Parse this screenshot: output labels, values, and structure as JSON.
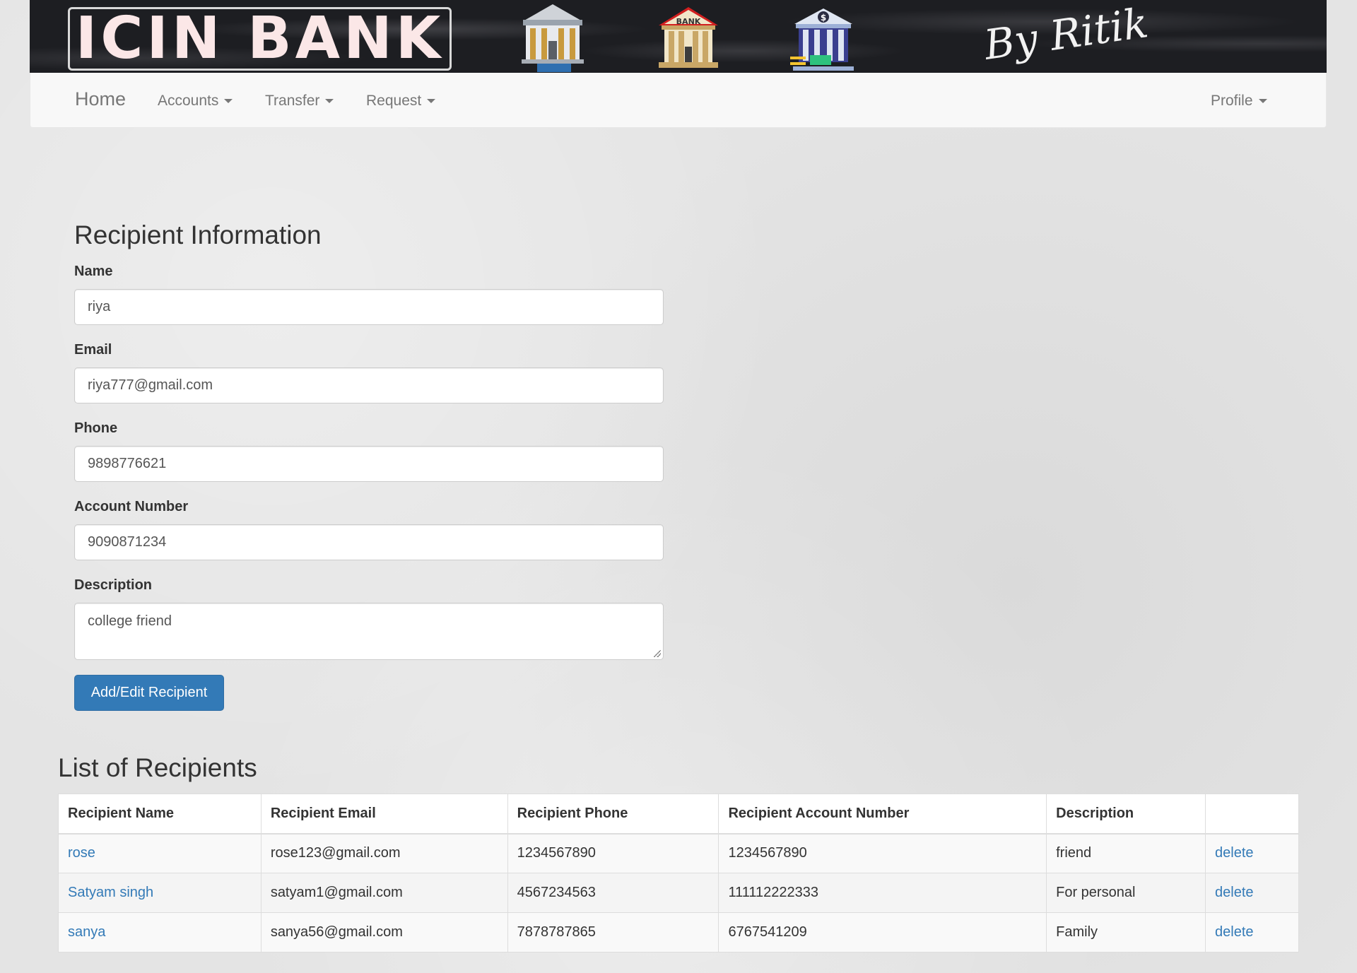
{
  "brand": {
    "logo_text": "ICIN BANK",
    "bank_sign": "BANK",
    "signature": "By Ritik"
  },
  "nav": {
    "home": "Home",
    "accounts": "Accounts",
    "transfer": "Transfer",
    "request": "Request",
    "profile": "Profile"
  },
  "form": {
    "title": "Recipient Information",
    "name_label": "Name",
    "name_value": "riya",
    "email_label": "Email",
    "email_value": "riya777@gmail.com",
    "phone_label": "Phone",
    "phone_value": "9898776621",
    "account_label": "Account Number",
    "account_value": "9090871234",
    "description_label": "Description",
    "description_value": "college friend",
    "submit_label": "Add/Edit Recipient"
  },
  "list": {
    "title": "List of Recipients",
    "headers": [
      "Recipient Name",
      "Recipient Email",
      "Recipient Phone",
      "Recipient Account Number",
      "Description",
      ""
    ],
    "rows": [
      {
        "name": "rose",
        "email": "rose123@gmail.com",
        "phone": "1234567890",
        "account": "1234567890",
        "description": "friend",
        "action": "delete"
      },
      {
        "name": "Satyam singh",
        "email": "satyam1@gmail.com",
        "phone": "4567234563",
        "account": "111112222333",
        "description": "For personal",
        "action": "delete"
      },
      {
        "name": "sanya",
        "email": "sanya56@gmail.com",
        "phone": "7878787865",
        "account": "6767541209",
        "description": "Family",
        "action": "delete"
      }
    ]
  },
  "colors": {
    "primary": "#337ab7",
    "link": "#337ab7",
    "banner_bg": "#1d1e22",
    "logo_text": "#fbe7e7"
  }
}
